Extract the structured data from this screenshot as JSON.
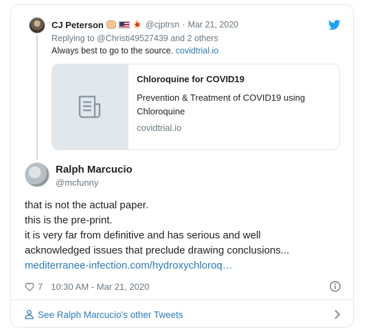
{
  "parent_tweet": {
    "name": "CJ Peterson",
    "emojis": [
      "fist-icon",
      "us-flag-icon",
      "collision-icon"
    ],
    "handle": "@cjptrsn",
    "separator": "·",
    "date": "Mar 21, 2020",
    "reply_line": "Replying to @Christi49527439 and 2 others",
    "text": "Always best to go to the source.",
    "text_link": "covidtrial.io",
    "link_card": {
      "title": "Chloroquine for COVID19",
      "description": "Prevention & Treatment of COVID19 using Chloroquine",
      "domain": "covidtrial.io",
      "thumbnail_icon": "document-icon"
    }
  },
  "main_tweet": {
    "name": "Ralph Marcucio",
    "handle": "@mcfunny",
    "lines": [
      "that is not the actual paper.",
      "this is the pre-print.",
      "it is very far from definitive and has serious and well",
      "acknowledged issues that preclude drawing conclusions..."
    ],
    "link": "mediterranee-infection.com/hydroxychloroq…",
    "likes": "7",
    "timestamp": "10:30 AM - Mar 21, 2020"
  },
  "footer": {
    "label": "See Ralph Marcucio's other Tweets"
  },
  "colors": {
    "link": "#2b7bb9",
    "muted": "#697882",
    "twitter_blue": "#1da1f2",
    "border": "#e1e8ed"
  }
}
